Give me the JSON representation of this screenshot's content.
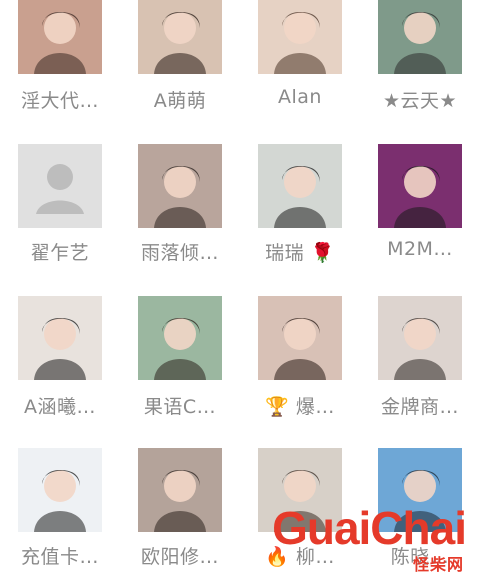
{
  "friends": [
    {
      "name": "淫大代…",
      "bg": "#c9a08f",
      "fg": "#3b2a24"
    },
    {
      "name": "A萌萌",
      "bg": "#d8c2b2",
      "fg": "#2a1d18"
    },
    {
      "name": "Alan",
      "bg": "#e6d2c4",
      "fg": "#4b3428"
    },
    {
      "name": "★云天★",
      "bg": "#7f9a8a",
      "fg": "#2d2d2d"
    },
    {
      "name": "翟乍艺",
      "bg": "#e0e0e0",
      "fg": "#bdbdbd"
    },
    {
      "name": "雨落倾…",
      "bg": "#b9a59c",
      "fg": "#2a211e"
    },
    {
      "name": "瑞瑞 🌹",
      "bg": "#d3d7d3",
      "fg": "#1f1f1f"
    },
    {
      "name": "M2M…",
      "bg": "#7b2f6f",
      "fg": "#1a1a1a"
    },
    {
      "name": "A涵曦…",
      "bg": "#e8e2dd",
      "fg": "#1c1c1c"
    },
    {
      "name": "果语C…",
      "bg": "#9bb7a0",
      "fg": "#2c241e"
    },
    {
      "name": "🏆 爆…",
      "bg": "#d8c1b6",
      "fg": "#2a1b16"
    },
    {
      "name": "金牌商…",
      "bg": "#ddd4cf",
      "fg": "#2a2422"
    },
    {
      "name": "充值卡…",
      "bg": "#eef1f4",
      "fg": "#1f1f1f"
    },
    {
      "name": "欧阳修…",
      "bg": "#b4a39a",
      "fg": "#2b221e"
    },
    {
      "name": "🔥 柳…",
      "bg": "#d7d0c8",
      "fg": "#3b2d25"
    },
    {
      "name": "陈晓…",
      "bg": "#6ea7d6",
      "fg": "#1e2833"
    }
  ],
  "watermark": {
    "brand": "GuaiChai",
    "subtitle": "怪柴网"
  }
}
